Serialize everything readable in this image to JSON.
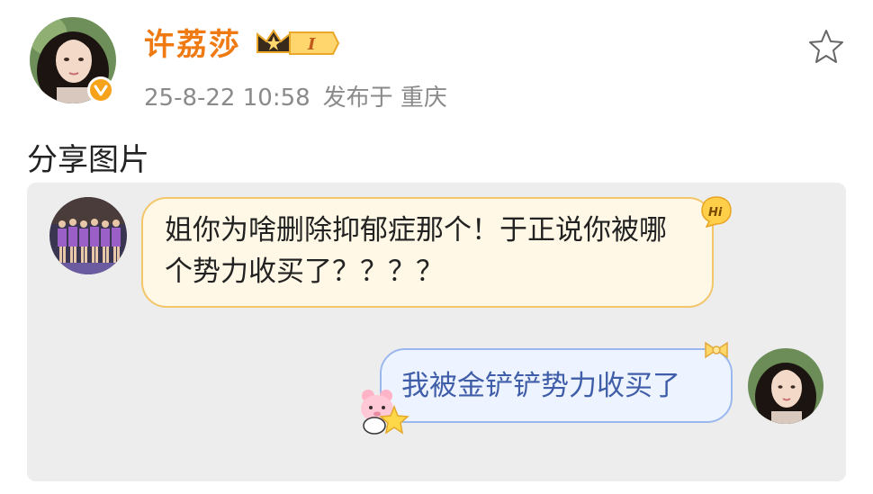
{
  "author": {
    "name": "许荔莎",
    "vip_level": "I"
  },
  "meta": {
    "date": "25-8-22 10:58",
    "posted_at": "发布于 重庆"
  },
  "post": {
    "text": "分享图片"
  },
  "chat": {
    "left_message": "姐你为啥删除抑郁症那个！于正说你被哪个势力收买了？？？？",
    "left_badge": "Hi",
    "right_message": "我被金铲铲势力收买了"
  },
  "colors": {
    "name": "#f07a12",
    "meta": "#8a8a8a",
    "left_bubble_border": "#f3c66a",
    "right_bubble_border": "#9bb8ee",
    "right_text": "#3f5da8"
  }
}
